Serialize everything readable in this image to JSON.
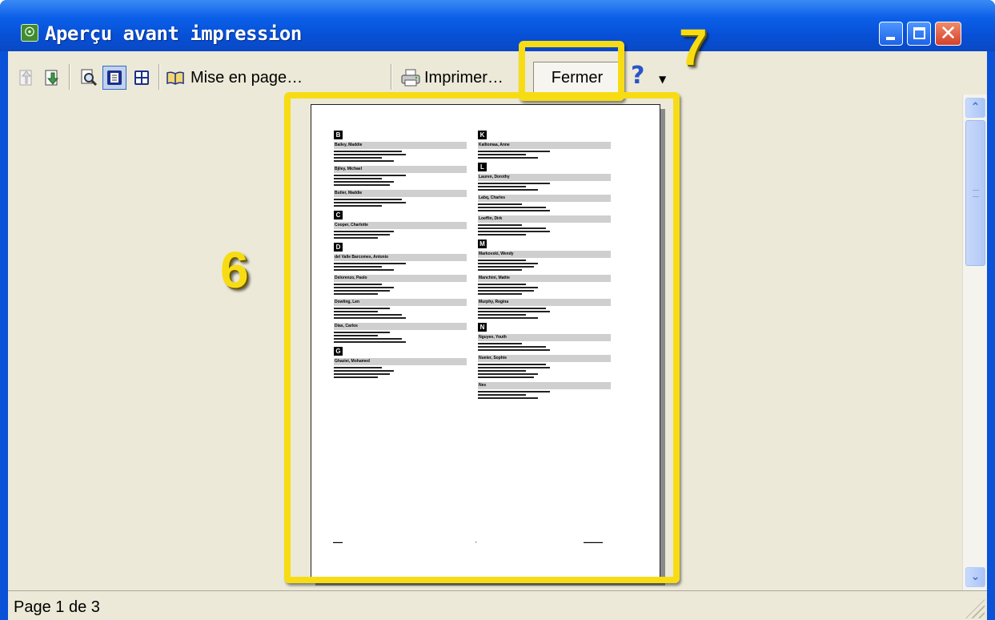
{
  "window": {
    "title": "Aperçu avant impression"
  },
  "toolbar": {
    "page_setup_label": "Mise en page…",
    "print_label": "Imprimer…",
    "close_label": "Fermer",
    "help_glyph": "?"
  },
  "page": {
    "col1": [
      {
        "letter": "B",
        "entries": [
          {
            "name": "Bailey, Maddie",
            "lines": [
              4
            ]
          },
          {
            "name": "Bjiley, Michael",
            "lines": [
              4
            ]
          },
          {
            "name": "Butler, Maddie",
            "lines": [
              3
            ]
          }
        ]
      },
      {
        "letter": "C",
        "entries": [
          {
            "name": "Cooper, Charlotte",
            "lines": [
              3
            ]
          }
        ]
      },
      {
        "letter": "D",
        "entries": [
          {
            "name": "del Valle Barcomes, Antonio",
            "lines": [
              3
            ]
          },
          {
            "name": "Delorenzo, Paolo",
            "lines": [
              4
            ]
          },
          {
            "name": "Dowling, Len",
            "lines": [
              4
            ]
          },
          {
            "name": "Dias, Carlos",
            "lines": [
              4
            ]
          }
        ]
      },
      {
        "letter": "G",
        "entries": [
          {
            "name": "Ghaziei, Mohamed",
            "lines": [
              4
            ]
          }
        ]
      }
    ],
    "col2": [
      {
        "letter": "K",
        "entries": [
          {
            "name": "Kalliomaa, Anne",
            "lines": [
              3
            ]
          }
        ]
      },
      {
        "letter": "L",
        "entries": [
          {
            "name": "Lauren, Dorothy",
            "lines": [
              3
            ]
          },
          {
            "name": "Labq, Charles",
            "lines": [
              3
            ]
          },
          {
            "name": "Loeffin, Dirk",
            "lines": [
              4
            ]
          }
        ]
      },
      {
        "letter": "M",
        "entries": [
          {
            "name": "Markovski, Wendy",
            "lines": [
              4
            ]
          },
          {
            "name": "Manchini, Mattie",
            "lines": [
              4
            ]
          },
          {
            "name": "Murphy, Regina",
            "lines": [
              4
            ]
          }
        ]
      },
      {
        "letter": "N",
        "entries": [
          {
            "name": "Nguyen, Youth",
            "lines": [
              3
            ]
          },
          {
            "name": "Nueter, Sophie",
            "lines": [
              5
            ]
          },
          {
            "name": "Nes",
            "lines": [
              3
            ]
          }
        ]
      }
    ]
  },
  "callouts": {
    "page_number": "6",
    "close_number": "7"
  },
  "status": {
    "text": "Page 1 de 3"
  },
  "colors": {
    "highlight": "#f7dc14",
    "titlebar": "#0750d6"
  }
}
